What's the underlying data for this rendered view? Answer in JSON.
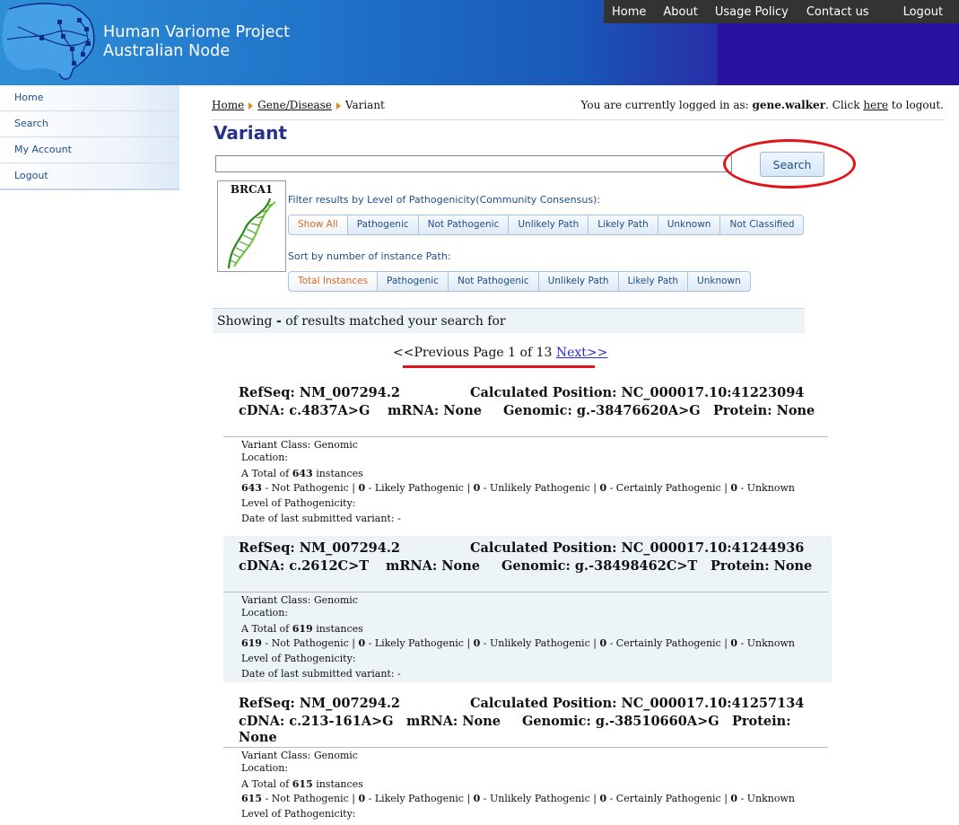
{
  "header": {
    "title_line1": "Human Variome Project",
    "title_line2": "Australian Node",
    "nav": [
      "Home",
      "About",
      "Usage Policy",
      "Contact us",
      "Logout"
    ]
  },
  "sidebar": {
    "items": [
      {
        "label": "Home"
      },
      {
        "label": "Search"
      },
      {
        "label": "My Account"
      },
      {
        "label": "Logout"
      }
    ]
  },
  "breadcrumb": {
    "home": "Home",
    "gene": "Gene/Disease",
    "current": "Variant"
  },
  "login": {
    "prefix": "You are currently logged in as: ",
    "user": "gene.walker",
    "mid": ". Click ",
    "link": "here",
    "suffix": " to logout."
  },
  "page_title": "Variant",
  "search": {
    "value": "",
    "button": "Search"
  },
  "gene": {
    "name": "BRCA1",
    "icon": "dna-helix-icon"
  },
  "filter": {
    "label": "Filter results by Level of Pathogenicity(Community Consensus):",
    "buttons": [
      "Show All",
      "Pathogenic",
      "Not Pathogenic",
      "Unlikely Path",
      "Likely Path",
      "Unknown",
      "Not Classified"
    ],
    "active": "Show All"
  },
  "sort": {
    "label": "Sort by number of instance Path:",
    "buttons": [
      "Total Instances",
      "Pathogenic",
      "Not Pathogenic",
      "Unlikely Path",
      "Likely Path",
      "Unknown"
    ],
    "active": "Total Instances"
  },
  "showing": {
    "prefix": "Showing ",
    "dash": "-",
    "suffix": " of results matched your search for"
  },
  "pager": {
    "prev": "<<Previous",
    "page_text": " Page 1 of 13 ",
    "next": "Next>>"
  },
  "variants": [
    {
      "refseq": "RefSeq: NM_007294.2",
      "calc_pos": "Calculated Position: NC_000017.10:41223094",
      "cdna": "cDNA: c.4837A>G",
      "mrna": "mRNA: None",
      "genomic": "Genomic: g.-38476620A>G",
      "protein": "Protein: None",
      "protein_wrap": "",
      "variant_class": "Variant Class: Genomic",
      "location": "Location:",
      "total_prefix": "A Total of ",
      "total": "643",
      "total_suffix": " instances",
      "counts": [
        "643",
        "0",
        "0",
        "0",
        "0"
      ],
      "count_labels": [
        " - Not Pathogenic | ",
        " - Likely Pathogenic | ",
        " - Unlikely Pathogenic | ",
        " - Certainly Pathogenic | ",
        " - Unknown"
      ],
      "level": "Level of Pathogenicity:",
      "date": "Date of last submitted variant: -"
    },
    {
      "refseq": "RefSeq: NM_007294.2",
      "calc_pos": "Calculated Position: NC_000017.10:41244936",
      "cdna": "cDNA: c.2612C>T",
      "mrna": "mRNA: None",
      "genomic": "Genomic: g.-38498462C>T",
      "protein": "Protein: None",
      "protein_wrap": "",
      "variant_class": "Variant Class: Genomic",
      "location": "Location:",
      "total_prefix": "A Total of ",
      "total": "619",
      "total_suffix": " instances",
      "counts": [
        "619",
        "0",
        "0",
        "0",
        "0"
      ],
      "count_labels": [
        " - Not Pathogenic | ",
        " - Likely Pathogenic | ",
        " - Unlikely Pathogenic | ",
        " - Certainly Pathogenic | ",
        " - Unknown"
      ],
      "level": "Level of Pathogenicity:",
      "date": "Date of last submitted variant: -"
    },
    {
      "refseq": "RefSeq: NM_007294.2",
      "calc_pos": "Calculated Position: NC_000017.10:41257134",
      "cdna": "cDNA: c.213-161A>G",
      "mrna": "mRNA: None",
      "genomic": "Genomic: g.-38510660A>G",
      "protein": "Protein:",
      "protein_wrap": "None",
      "variant_class": "Variant Class: Genomic",
      "location": "Location:",
      "total_prefix": "A Total of ",
      "total": "615",
      "total_suffix": " instances",
      "counts": [
        "615",
        "0",
        "0",
        "0",
        "0"
      ],
      "count_labels": [
        " - Not Pathogenic | ",
        " - Likely Pathogenic | ",
        " - Unlikely Pathogenic | ",
        " - Certainly Pathogenic | ",
        " - Unknown"
      ],
      "level": "Level of Pathogenicity:",
      "date": ""
    }
  ],
  "colors": {
    "nav_bg": "#333333",
    "title_blue": "#26318a",
    "link_blue": "#1d4d8a",
    "active_orange": "#d9692b",
    "annotation_red": "#e0141a",
    "row_alt": "#edf4f8"
  }
}
